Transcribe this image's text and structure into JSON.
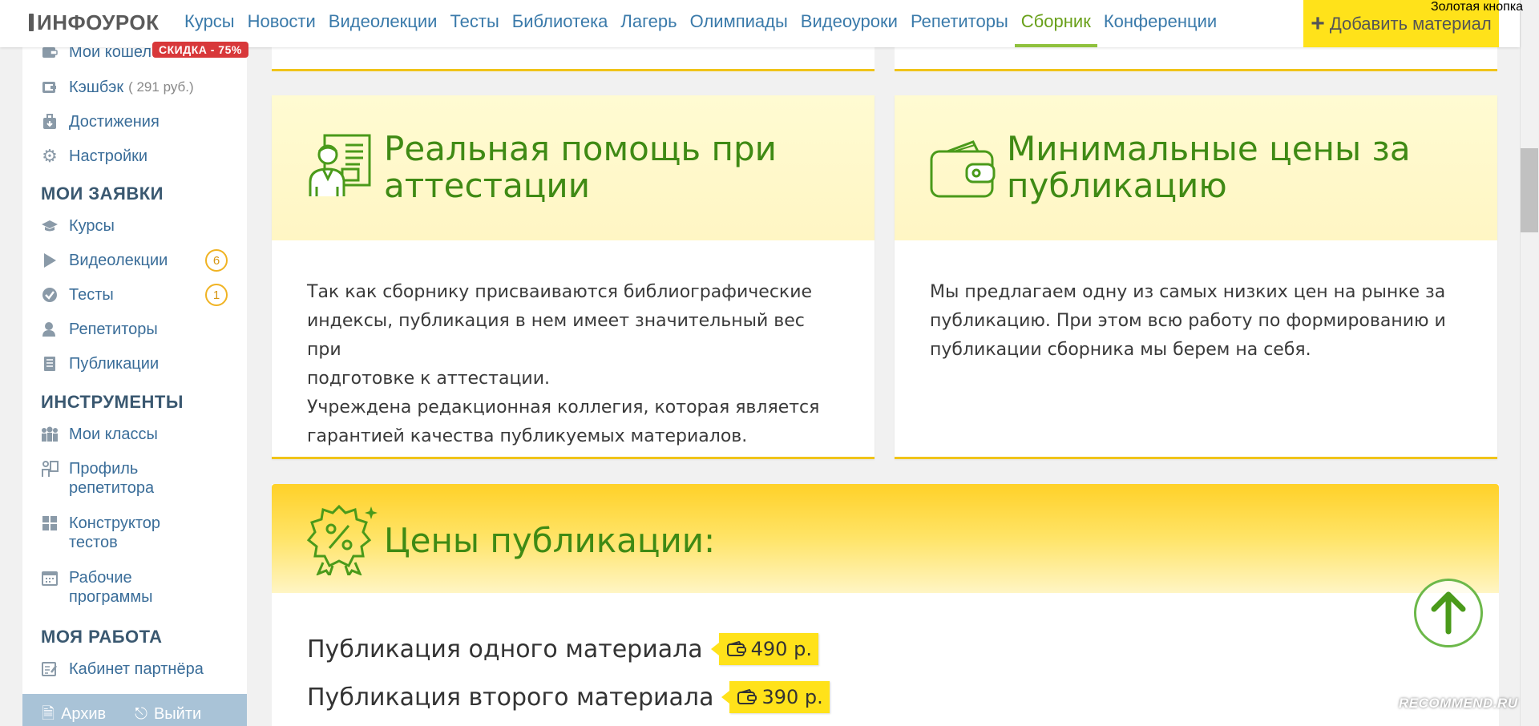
{
  "header": {
    "logo": "ИНФОУРОК",
    "nav": [
      "Курсы",
      "Новости",
      "Видеолекции",
      "Тесты",
      "Библиотека",
      "Лагерь",
      "Олимпиады",
      "Видеоуроки",
      "Репетиторы",
      "Сборник",
      "Конференции"
    ],
    "active_nav": "Сборник",
    "add_material": "Добавить материал",
    "gold_button": "Золотая кнопка"
  },
  "sidebar": {
    "discount_badge": "СКИДКА - 75%",
    "account": [
      {
        "label": "Мой кошелёк",
        "icon": "wallet-icon"
      },
      {
        "label": "Кэшбэк",
        "extra": "( 291 руб.)",
        "icon": "cashback-icon"
      },
      {
        "label": "Достижения",
        "icon": "achievement-icon"
      },
      {
        "label": "Настройки",
        "icon": "gear-icon"
      }
    ],
    "requests_heading": "МОИ ЗАЯВКИ",
    "requests": [
      {
        "label": "Курсы",
        "icon": "graduation-cap-icon"
      },
      {
        "label": "Видеолекции",
        "icon": "play-icon",
        "count": "6"
      },
      {
        "label": "Тесты",
        "icon": "check-circle-icon",
        "count": "1"
      },
      {
        "label": "Репетиторы",
        "icon": "tutor-icon"
      },
      {
        "label": "Публикации",
        "icon": "book-icon"
      }
    ],
    "tools_heading": "ИНСТРУМЕНТЫ",
    "tools": [
      {
        "label": "Мои классы",
        "icon": "group-icon"
      },
      {
        "label": "Профиль репетитора",
        "line1": "Профиль",
        "line2": "репетитора",
        "icon": "profile-icon"
      },
      {
        "label": "Конструктор тестов",
        "line1": "Конструктор",
        "line2": "тестов",
        "icon": "grid-icon"
      },
      {
        "label": "Рабочие программы",
        "line1": "Рабочие",
        "line2": "программы",
        "icon": "calendar-icon"
      }
    ],
    "work_heading": "МОЯ РАБОТА",
    "work": [
      {
        "label": "Кабинет партнёра",
        "icon": "partner-icon"
      }
    ],
    "bottom": {
      "archive": "Архив",
      "logout": "Выйти"
    }
  },
  "cards": [
    {
      "title_line1": "Реальная помощь при",
      "title_line2": "аттестации",
      "body_line1": "Так как сборнику присваиваются библиографические",
      "body_line2": "индексы, публикация в нем имеет значительный вес при",
      "body_line3": "подготовке к аттестации.",
      "body_line4": "Учреждена редакционная коллегия, которая является",
      "body_line5": "гарантией качества публикуемых материалов."
    },
    {
      "title_line1": "Минимальные цены за",
      "title_line2": "публикацию",
      "body_line1": "Мы предлагаем одну из самых низких цен на рынке за",
      "body_line2": "публикацию. При этом всю работу по формированию и",
      "body_line3": "публикации сборника мы берем на себя."
    }
  ],
  "prices": {
    "title": "Цены публикации:",
    "rows": [
      {
        "label": "Публикация одного материала",
        "price": "490 р."
      },
      {
        "label": "Публикация второго материала",
        "price": "390 р."
      }
    ]
  },
  "watermark": "RECOMMEND.RU",
  "colors": {
    "accent_green": "#3f8a14",
    "link_blue": "#3a7aaa",
    "yellow": "#ffe21a",
    "discount_red": "#d8383a"
  }
}
